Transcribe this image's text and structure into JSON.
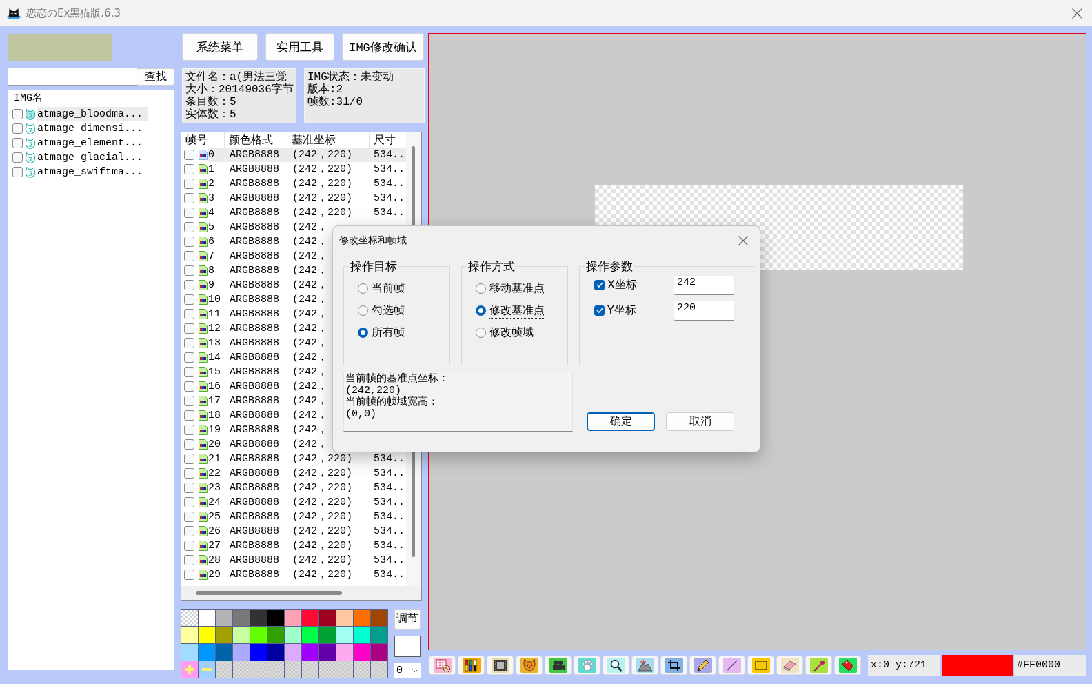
{
  "window": {
    "title": "恋恋のEx黑猫版.6.3"
  },
  "sidebar": {
    "search_button": "查找",
    "list_header": "IMG名",
    "items": [
      {
        "name": "atmage_bloodma...",
        "checked": false,
        "selected": true
      },
      {
        "name": "atmage_dimensi...",
        "checked": false,
        "selected": false
      },
      {
        "name": "atmage_element...",
        "checked": false,
        "selected": false
      },
      {
        "name": "atmage_glacial...",
        "checked": false,
        "selected": false
      },
      {
        "name": "atmage_swiftma...",
        "checked": false,
        "selected": false
      }
    ]
  },
  "actions": [
    {
      "label": "系统菜单"
    },
    {
      "label": "实用工具"
    },
    {
      "label": "IMG修改确认"
    }
  ],
  "file_info": [
    "文件名：a(男法三觉",
    "大小：20149036字节",
    "条目数：5",
    "实体数：5"
  ],
  "img_info": [
    "IMG状态：未变动",
    "版本:2",
    "帧数:31/0"
  ],
  "frame_table": {
    "columns": [
      "帧号",
      "颜色格式",
      "基准坐标",
      "尺寸"
    ],
    "rows": [
      {
        "no": "0",
        "format": "ARGB8888",
        "coord": "(242，220)",
        "size": "534..",
        "checked": false,
        "selected": true
      },
      {
        "no": "1",
        "format": "ARGB8888",
        "coord": "(242，220)",
        "size": "534..",
        "checked": false,
        "selected": false
      },
      {
        "no": "2",
        "format": "ARGB8888",
        "coord": "(242，220)",
        "size": "534..",
        "checked": false,
        "selected": false
      },
      {
        "no": "3",
        "format": "ARGB8888",
        "coord": "(242，220)",
        "size": "534..",
        "checked": false,
        "selected": false
      },
      {
        "no": "4",
        "format": "ARGB8888",
        "coord": "(242，220)",
        "size": "534..",
        "checked": false,
        "selected": false
      },
      {
        "no": "5",
        "format": "ARGB8888",
        "coord": "(242，",
        "checked": false,
        "selected": false
      },
      {
        "no": "6",
        "format": "ARGB8888",
        "coord": "(242，",
        "checked": false,
        "selected": false
      },
      {
        "no": "7",
        "format": "ARGB8888",
        "coord": "(242，",
        "checked": false,
        "selected": false
      },
      {
        "no": "8",
        "format": "ARGB8888",
        "coord": "(242，",
        "checked": false,
        "selected": false
      },
      {
        "no": "9",
        "format": "ARGB8888",
        "coord": "(242，",
        "checked": false,
        "selected": false
      },
      {
        "no": "10",
        "format": "ARGB8888",
        "coord": "(242，",
        "checked": false,
        "selected": false
      },
      {
        "no": "11",
        "format": "ARGB8888",
        "coord": "(242，",
        "checked": false,
        "selected": false
      },
      {
        "no": "12",
        "format": "ARGB8888",
        "coord": "(242，",
        "checked": false,
        "selected": false
      },
      {
        "no": "13",
        "format": "ARGB8888",
        "coord": "(242，",
        "checked": false,
        "selected": false
      },
      {
        "no": "14",
        "format": "ARGB8888",
        "coord": "(242，",
        "checked": false,
        "selected": false
      },
      {
        "no": "15",
        "format": "ARGB8888",
        "coord": "(242，",
        "checked": false,
        "selected": false
      },
      {
        "no": "16",
        "format": "ARGB8888",
        "coord": "(242，",
        "checked": false,
        "selected": false
      },
      {
        "no": "17",
        "format": "ARGB8888",
        "coord": "(242，",
        "checked": false,
        "selected": false
      },
      {
        "no": "18",
        "format": "ARGB8888",
        "coord": "(242，",
        "checked": false,
        "selected": false
      },
      {
        "no": "19",
        "format": "ARGB8888",
        "coord": "(242，",
        "checked": false,
        "selected": false
      },
      {
        "no": "20",
        "format": "ARGB8888",
        "coord": "(242，",
        "checked": false,
        "selected": false
      },
      {
        "no": "21",
        "format": "ARGB8888",
        "coord": "(242，220)",
        "size": "534..",
        "checked": false,
        "selected": false
      },
      {
        "no": "22",
        "format": "ARGB8888",
        "coord": "(242，220)",
        "size": "534..",
        "checked": false,
        "selected": false
      },
      {
        "no": "23",
        "format": "ARGB8888",
        "coord": "(242，220)",
        "size": "534..",
        "checked": false,
        "selected": false
      },
      {
        "no": "24",
        "format": "ARGB8888",
        "coord": "(242，220)",
        "size": "534..",
        "checked": false,
        "selected": false
      },
      {
        "no": "25",
        "format": "ARGB8888",
        "coord": "(242，220)",
        "size": "534..",
        "checked": false,
        "selected": false
      },
      {
        "no": "26",
        "format": "ARGB8888",
        "coord": "(242，220)",
        "size": "534..",
        "checked": false,
        "selected": false
      },
      {
        "no": "27",
        "format": "ARGB8888",
        "coord": "(242，220)",
        "size": "534..",
        "checked": false,
        "selected": false
      },
      {
        "no": "28",
        "format": "ARGB8888",
        "coord": "(242，220)",
        "size": "534..",
        "checked": false,
        "selected": false
      },
      {
        "no": "29",
        "format": "ARGB8888",
        "coord": "(242，220)",
        "size": "534..",
        "checked": false,
        "selected": false
      }
    ]
  },
  "palette": {
    "swatches": [
      {
        "kind": "transparent"
      },
      {
        "kind": "color",
        "color": "#ffffff"
      },
      {
        "kind": "color",
        "color": "#b4b4b4"
      },
      {
        "kind": "color",
        "color": "#787878"
      },
      {
        "kind": "color",
        "color": "#323232"
      },
      {
        "kind": "color",
        "color": "#000000"
      },
      {
        "kind": "color",
        "color": "#ffa0b4"
      },
      {
        "kind": "color",
        "color": "#ff0a32"
      },
      {
        "kind": "color",
        "color": "#a00020"
      },
      {
        "kind": "color",
        "color": "#ffc8a0"
      },
      {
        "kind": "color",
        "color": "#ff6e00"
      },
      {
        "kind": "color",
        "color": "#a04600"
      },
      {
        "kind": "color",
        "color": "#ffffa0"
      },
      {
        "kind": "color",
        "color": "#ffff00"
      },
      {
        "kind": "color",
        "color": "#a0a000"
      },
      {
        "kind": "color",
        "color": "#c8ffa0"
      },
      {
        "kind": "color",
        "color": "#64ff00"
      },
      {
        "kind": "color",
        "color": "#32a000"
      },
      {
        "kind": "color",
        "color": "#a0ffc8"
      },
      {
        "kind": "color",
        "color": "#00ff46"
      },
      {
        "kind": "color",
        "color": "#00a032"
      },
      {
        "kind": "color",
        "color": "#a0fff0"
      },
      {
        "kind": "color",
        "color": "#00ffd2"
      },
      {
        "kind": "color",
        "color": "#00a08c"
      },
      {
        "kind": "color",
        "color": "#a0dcff"
      },
      {
        "kind": "color",
        "color": "#0096ff"
      },
      {
        "kind": "color",
        "color": "#0064aa"
      },
      {
        "kind": "color",
        "color": "#aaaaff"
      },
      {
        "kind": "color",
        "color": "#0000ff"
      },
      {
        "kind": "color",
        "color": "#0000a0"
      },
      {
        "kind": "color",
        "color": "#dcaaff"
      },
      {
        "kind": "color",
        "color": "#a000ff"
      },
      {
        "kind": "color",
        "color": "#6400aa"
      },
      {
        "kind": "color",
        "color": "#ffaaf0"
      },
      {
        "kind": "color",
        "color": "#ff00c8"
      },
      {
        "kind": "color",
        "color": "#aa0082"
      },
      {
        "kind": "add"
      },
      {
        "kind": "remove"
      },
      {
        "kind": "empty"
      },
      {
        "kind": "empty"
      },
      {
        "kind": "empty"
      },
      {
        "kind": "empty"
      },
      {
        "kind": "empty"
      },
      {
        "kind": "empty"
      },
      {
        "kind": "empty"
      },
      {
        "kind": "empty"
      },
      {
        "kind": "empty"
      },
      {
        "kind": "empty"
      }
    ],
    "adjust_button": "调节",
    "current_swatch": {
      "color": "#ffffff"
    },
    "dropdown_value": "0"
  },
  "tools": [
    {
      "kind": "picture"
    },
    {
      "kind": "color-bars"
    },
    {
      "kind": "film"
    },
    {
      "kind": "cat"
    },
    {
      "kind": "camera"
    },
    {
      "kind": "paw"
    },
    {
      "kind": "search"
    },
    {
      "kind": "mountain"
    },
    {
      "kind": "crop"
    },
    {
      "kind": "pencil"
    },
    {
      "kind": "line"
    },
    {
      "kind": "rectangle"
    },
    {
      "kind": "eraser"
    },
    {
      "kind": "eyedropper"
    },
    {
      "kind": "tag"
    }
  ],
  "status_bar": {
    "position": "x:0 y:721",
    "color": "#ff0000",
    "color_code": "#FF0000"
  },
  "dialog": {
    "title": "修改坐标和帧域",
    "groups": [
      {
        "kind": "radio",
        "title": "操作目标",
        "options": [
          {
            "label": "当前帧",
            "selected": false,
            "focused": false
          },
          {
            "label": "勾选帧",
            "selected": false,
            "focused": false
          },
          {
            "label": "所有帧",
            "selected": true,
            "focused": false
          }
        ]
      },
      {
        "kind": "radio",
        "title": "操作方式",
        "options": [
          {
            "label": "移动基准点",
            "selected": false,
            "focused": false
          },
          {
            "label": "修改基准点",
            "selected": true,
            "focused": true
          },
          {
            "label": "修改帧域",
            "selected": false,
            "focused": false
          }
        ]
      },
      {
        "kind": "params",
        "title": "操作参数",
        "fields": [
          {
            "label": "X坐标",
            "checked": true,
            "value": "242"
          },
          {
            "label": "Y坐标",
            "checked": true,
            "value": "220"
          }
        ]
      }
    ],
    "info": [
      "当前帧的基准点坐标：",
      "(242,220)",
      "当前帧的帧域宽高：",
      "(0,0)"
    ],
    "buttons": [
      {
        "label": "确定",
        "default": true
      },
      {
        "label": "取消",
        "default": false
      }
    ]
  }
}
